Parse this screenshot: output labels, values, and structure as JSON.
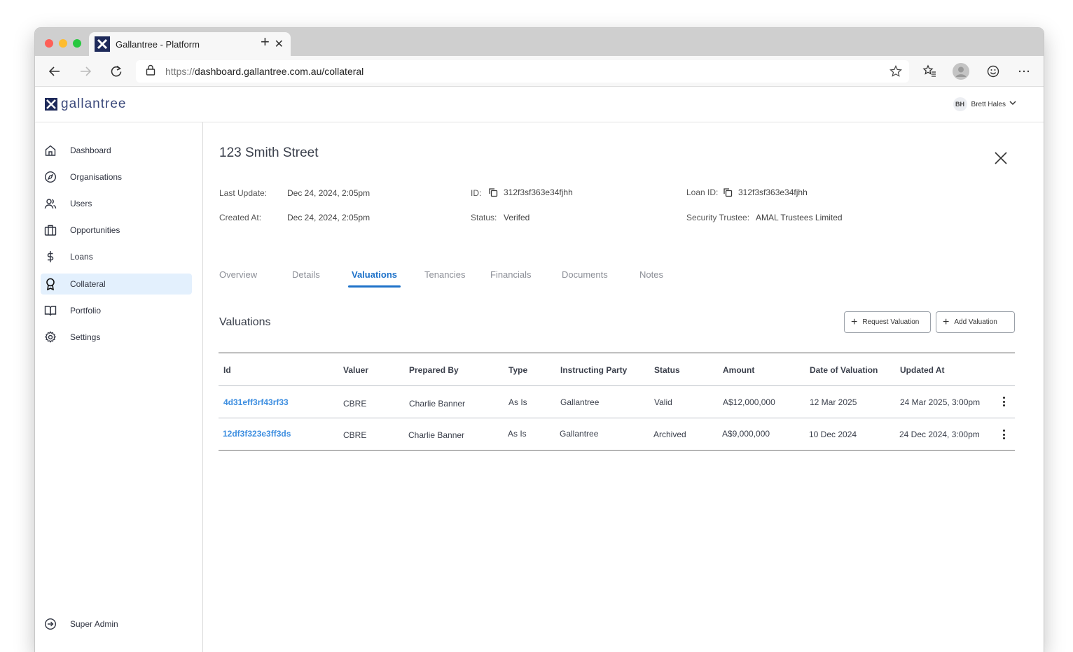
{
  "browser": {
    "tab_title": "Gallantree - Platform",
    "url_scheme": "https://",
    "url_rest": "dashboard.gallantree.com.au/collateral"
  },
  "app": {
    "logo_text": "gallantree",
    "user_initials": "BH",
    "user_name": "Brett Hales"
  },
  "sidebar": {
    "items": [
      {
        "label": "Dashboard",
        "icon": "home-icon"
      },
      {
        "label": "Organisations",
        "icon": "compass-icon"
      },
      {
        "label": "Users",
        "icon": "users-icon"
      },
      {
        "label": "Opportunities",
        "icon": "briefcase-icon"
      },
      {
        "label": "Loans",
        "icon": "dollar-icon"
      },
      {
        "label": "Collateral",
        "icon": "award-icon",
        "active": true
      },
      {
        "label": "Portfolio",
        "icon": "book-icon"
      },
      {
        "label": "Settings",
        "icon": "gear-icon"
      }
    ],
    "footer_label": "Super Admin"
  },
  "detail": {
    "title": "123 Smith Street",
    "last_update_label": "Last Update:",
    "last_update_value": "Dec 24, 2024, 2:05pm",
    "created_at_label": "Created At:",
    "created_at_value": "Dec 24, 2024, 2:05pm",
    "id_label": "ID:",
    "id_value": "312f3sf363e34fjhh",
    "status_label": "Status:",
    "status_value": "Verifed",
    "loan_id_label": "Loan ID:",
    "loan_id_value": "312f3sf363e34fjhh",
    "trustee_label": "Security Trustee:",
    "trustee_value": "AMAL Trustees Limited"
  },
  "tabs": [
    "Overview",
    "Details",
    "Valuations",
    "Tenancies",
    "Financials",
    "Documents",
    "Notes"
  ],
  "active_tab": "Valuations",
  "valuations": {
    "section_title": "Valuations",
    "request_button": "Request Valuation",
    "add_button": "Add Valuation",
    "columns": [
      "Id",
      "Valuer",
      "Prepared By",
      "Type",
      "Instructing Party",
      "Status",
      "Amount",
      "Date of Valuation",
      "Updated At"
    ],
    "rows": [
      [
        "4d31eff3rf43rf33",
        "CBRE",
        "Charlie Banner",
        "As Is",
        "Gallantree",
        "Valid",
        "A$12,000,000",
        "12 Mar 2025",
        "24 Mar 2025, 3:00pm"
      ],
      [
        "12df3f323e3ff3ds",
        "CBRE",
        "Charlie Banner",
        "As Is",
        "Gallantree",
        "Archived",
        "A$9,000,000",
        "10 Dec 2024",
        "24 Dec 2024, 3:00pm"
      ]
    ]
  },
  "colors": {
    "accent": "#1e72c9",
    "link": "#3d8ee0",
    "active_nav_bg": "#e3f0fd",
    "brand_navy": "#1e2a5a"
  }
}
